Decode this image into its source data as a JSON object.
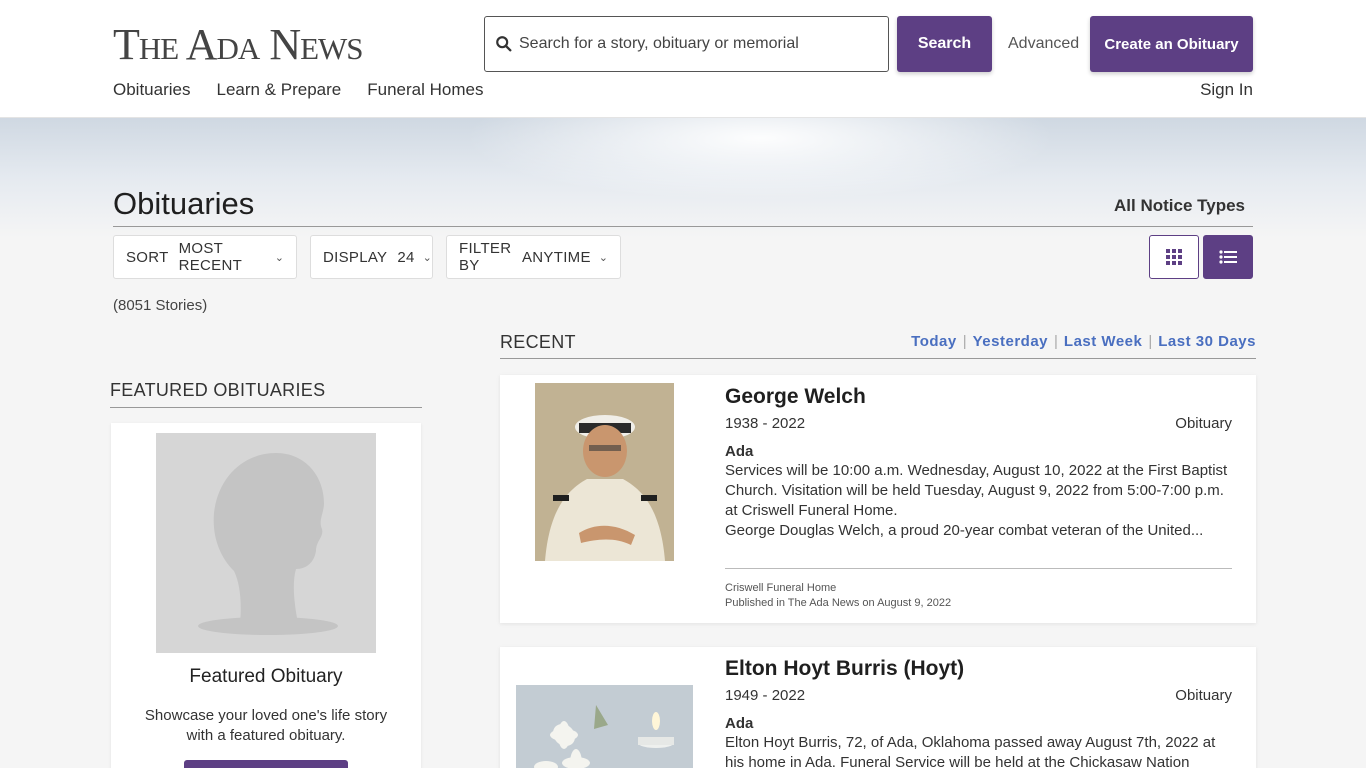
{
  "brand": {
    "logo_text": "The Ada News",
    "accent_color": "#5d3f84",
    "link_color": "#4a6fc0"
  },
  "search": {
    "placeholder": "Search for a story, obituary or memorial",
    "button_label": "Search",
    "advanced_label": "Advanced"
  },
  "header": {
    "create_button": "Create an Obituary",
    "sign_in": "Sign In"
  },
  "nav": {
    "items": [
      "Obituaries",
      "Learn & Prepare",
      "Funeral Homes"
    ]
  },
  "page": {
    "title": "Obituaries",
    "notice_types": "All Notice Types",
    "story_count": "(8051 Stories)"
  },
  "controls": {
    "sort": {
      "label": "SORT",
      "value": "MOST RECENT"
    },
    "display": {
      "label": "DISPLAY",
      "value": "24"
    },
    "filter": {
      "label": "FILTER BY",
      "value": "ANYTIME"
    },
    "views": [
      {
        "icon": "grid-icon",
        "active": false
      },
      {
        "icon": "list-icon",
        "active": true
      }
    ]
  },
  "featured": {
    "heading": "FEATURED OBITUARIES",
    "card_title": "Featured Obituary",
    "card_desc": "Showcase your loved one's life story with a featured obituary."
  },
  "recent": {
    "heading": "RECENT",
    "filters": [
      "Today",
      "Yesterday",
      "Last Week",
      "Last 30 Days"
    ],
    "items": [
      {
        "name": "George Welch",
        "years": "1938 - 2022",
        "type": "Obituary",
        "city": "Ada",
        "excerpt": "Services will be 10:00 a.m. Wednesday, August 10, 2022 at the First Baptist Church. Visitation will be held Tuesday, August 9, 2022 from 5:00-7:00 p.m. at Criswell Funeral Home.\nGeorge Douglas Welch, a proud 20-year combat veteran of the United...",
        "funeral_home": "Criswell Funeral Home",
        "published": "Published in The Ada News on August 9, 2022"
      },
      {
        "name": "Elton Hoyt Burris (Hoyt)",
        "years": "1949 - 2022",
        "type": "Obituary",
        "city": "Ada",
        "excerpt": "Elton Hoyt Burris, 72, of Ada, Oklahoma passed away August 7th, 2022 at his home in Ada. Funeral Service will be held at the Chickasaw Nation"
      }
    ]
  }
}
